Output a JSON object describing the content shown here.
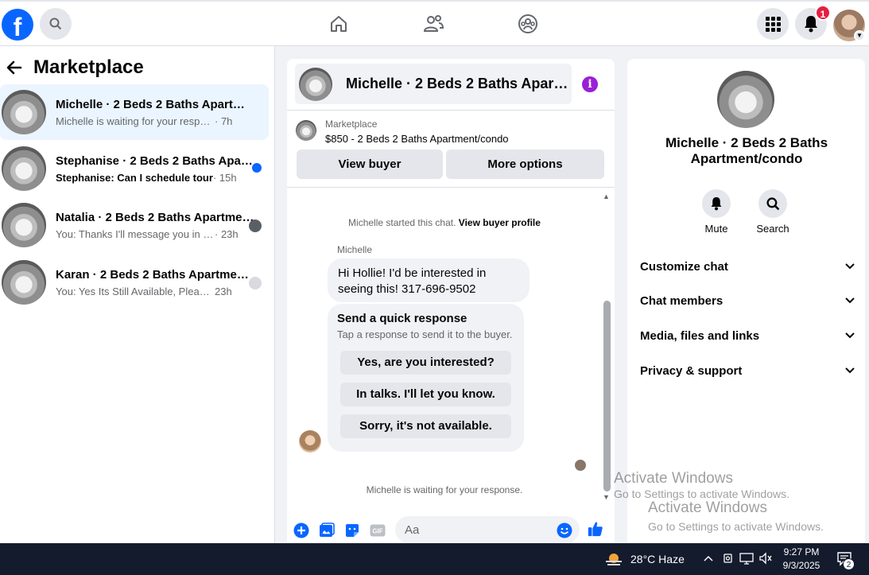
{
  "topbar": {
    "logo_letter": "f",
    "notification_count": "1"
  },
  "left_pane": {
    "title": "Marketplace",
    "conversations": [
      {
        "title": "Michelle · 2 Beds 2 Baths Apartment/condo",
        "preview": "Michelle is waiting for your response.",
        "time": " · 7h",
        "active": true,
        "unread": false
      },
      {
        "title": "Stephanise · 2 Beds 2 Baths Apartment/condo",
        "preview": "Stephanise: Can I schedule tour",
        "time": " · 15h",
        "active": false,
        "unread": true
      },
      {
        "title": "Natalia · 2 Beds 2 Baths Apartment/condo",
        "preview": "You: Thanks I'll message you in a ...",
        "time": " · 23h",
        "active": false,
        "unread": false
      },
      {
        "title": "Karan · 2 Beds 2 Baths Apartment/condo",
        "preview": "You: Yes Its Still Available, Please S...",
        "time": " 23h",
        "active": false,
        "unread": false
      }
    ]
  },
  "chat": {
    "header_title": "Michelle · 2 Beds 2 Baths Apartment/condo",
    "listing_label": "Marketplace",
    "listing_price": "$850 - 2 Beds 2 Baths Apartment/condo",
    "view_buyer": "View buyer",
    "more_options": "More options",
    "started_text": "Michelle started this chat.",
    "view_buyer_profile": "View buyer profile",
    "sender_name": "Michelle",
    "message": "Hi Hollie!  I'd be interested in seeing this!  317-696-9502",
    "quick_title": "Send a quick response",
    "quick_subtitle": "Tap a response to send it to the buyer.",
    "quick_options": [
      "Yes, are you interested?",
      "In talks. I'll let you know.",
      "Sorry, it's not available."
    ],
    "waiting_text": "Michelle is waiting for your response.",
    "composer_placeholder": "Aa",
    "gif_label": "GIF"
  },
  "right_pane": {
    "title": "Michelle · 2 Beds 2 Baths Apartment/condo",
    "mute_label": "Mute",
    "search_label": "Search",
    "sections": [
      "Customize chat",
      "Chat members",
      "Media, files and links",
      "Privacy & support"
    ]
  },
  "watermark": {
    "title": "Activate Windows",
    "subtitle": "Go to Settings to activate Windows."
  },
  "taskbar": {
    "weather": "28°C  Haze",
    "time": "9:27 PM",
    "date": "9/3/2025",
    "notification_count": "2"
  }
}
